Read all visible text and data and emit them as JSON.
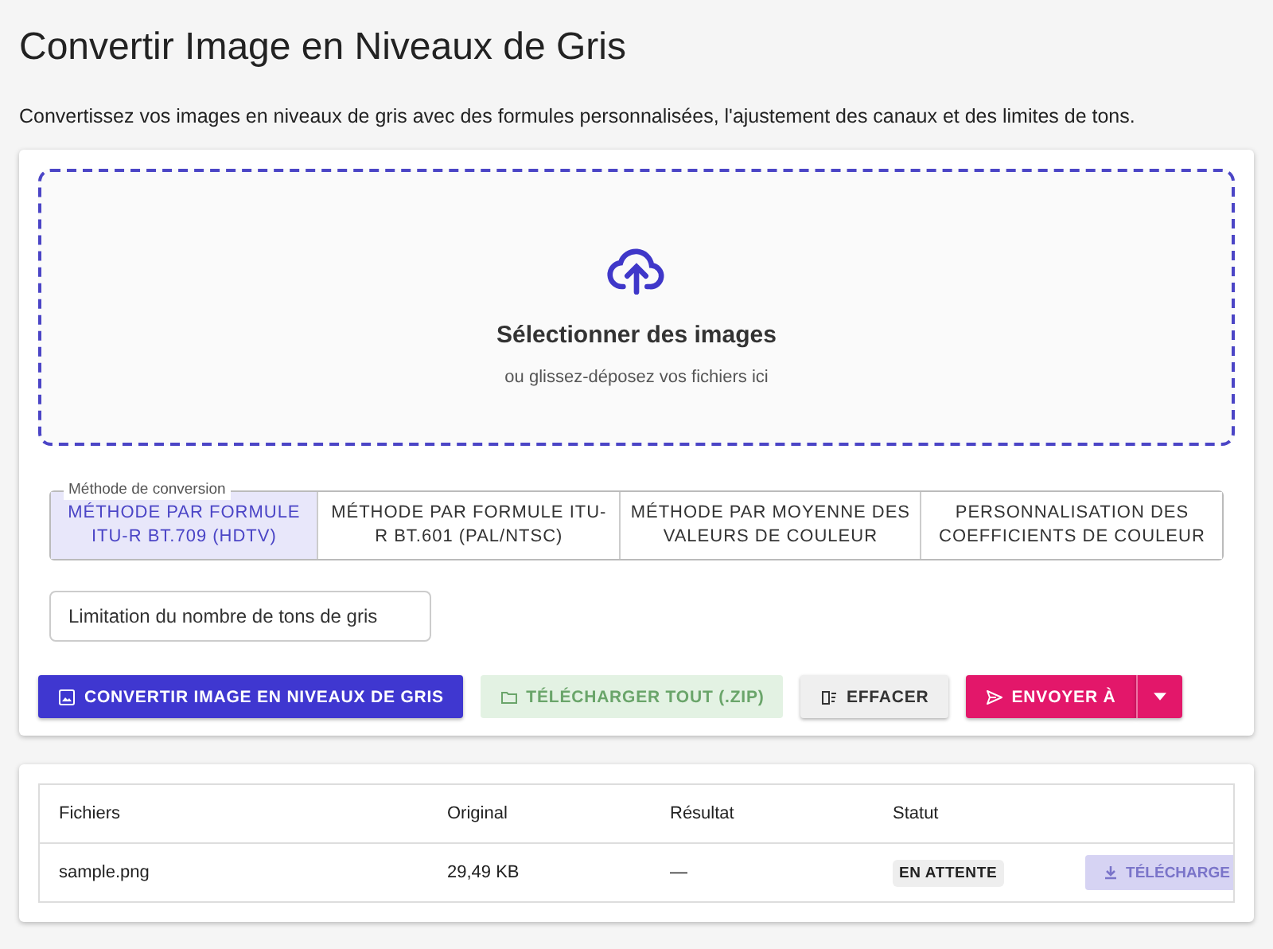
{
  "title": "Convertir Image en Niveaux de Gris",
  "description": "Convertissez vos images en niveaux de gris avec des formules personnalisées, l'ajustement des canaux et des limites de tons.",
  "dropzone": {
    "title": "Sélectionner des images",
    "hint": "ou glissez-déposez vos fichiers ici"
  },
  "method_group": {
    "legend": "Méthode de conversion",
    "options": [
      {
        "label": "MÉTHODE PAR FORMULE ITU-R BT.709 (HDTV)",
        "selected": true
      },
      {
        "label": "MÉTHODE PAR FORMULE ITU-R BT.601 (PAL/NTSC)",
        "selected": false
      },
      {
        "label": "MÉTHODE PAR MOYENNE DES VALEURS DE COULEUR",
        "selected": false
      },
      {
        "label": "PERSONNALISATION DES COEFFICIENTS DE COULEUR",
        "selected": false
      }
    ]
  },
  "tone_limit": {
    "label": "Limitation du nombre de tons de gris"
  },
  "actions": [
    {
      "kind": "convert",
      "label": "CONVERTIR IMAGE EN NIVEAUX DE GRIS",
      "disabled": false
    },
    {
      "kind": "zip",
      "label": "TÉLÉCHARGER TOUT (.ZIP)",
      "disabled": true
    },
    {
      "kind": "clear",
      "label": "EFFACER",
      "disabled": false
    },
    {
      "kind": "send",
      "label": "ENVOYER À",
      "disabled": false
    }
  ],
  "table": {
    "columns": [
      "Fichiers",
      "Original",
      "Résultat",
      "Statut"
    ],
    "rows": [
      {
        "file": "sample.png",
        "original": "29,49 KB",
        "result": "—",
        "status": "EN ATTENTE",
        "download": {
          "label": "TÉLÉCHARGE",
          "disabled": true
        }
      }
    ]
  }
}
